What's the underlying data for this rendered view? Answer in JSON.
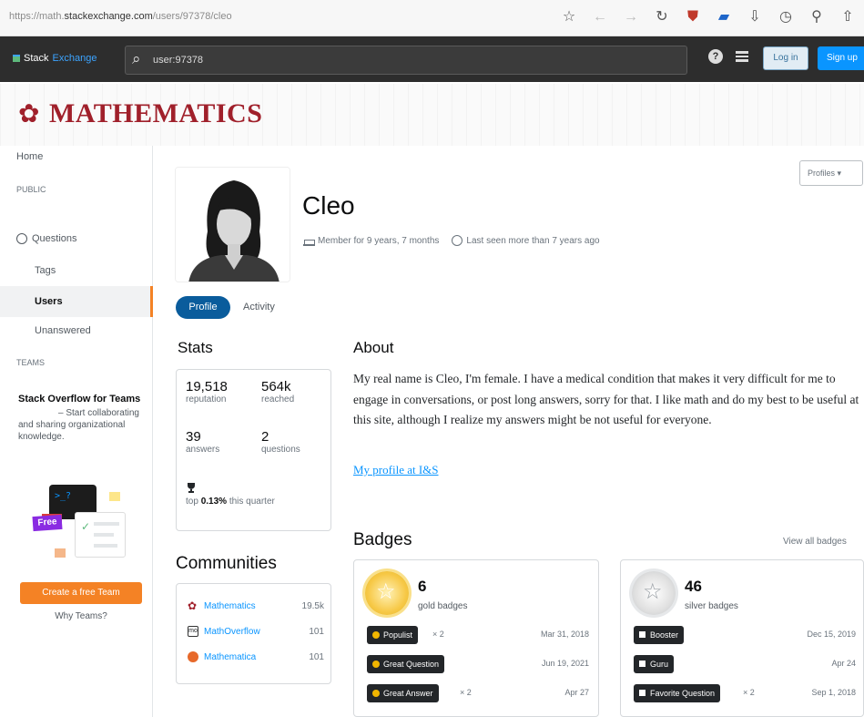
{
  "browser": {
    "url_prefix": "https://math.",
    "url_domain": "stackexchange.com",
    "url_path": "/users/97378/cleo"
  },
  "topbar": {
    "logo_stack": "Stack",
    "logo_exchange": "Exchange",
    "search_value": "user:97378",
    "help_icon": "?",
    "login_label": "Log in",
    "signup_label": "Sign up"
  },
  "site": {
    "name": "MATHEMATICS",
    "brand_color": "#a0202b"
  },
  "nav": {
    "home": "Home",
    "public_label": "PUBLIC",
    "questions": "Questions",
    "tags": "Tags",
    "users": "Users",
    "unanswered": "Unanswered",
    "teams_label": "TEAMS",
    "teams_title": "Stack Overflow for Teams",
    "teams_desc": "– Start collaborating and sharing organizational knowledge.",
    "illustration_prompt": ">_",
    "illustration_cursor": "?",
    "illustration_free": "Free",
    "create_team": "Create a free Team",
    "why_teams": "Why Teams?"
  },
  "profile": {
    "name": "Cleo",
    "member_for": "Member for 9 years, 7 months",
    "last_seen": "Last seen more than 7 years ago",
    "profiles_button": "Profiles ▾",
    "tab_profile": "Profile",
    "tab_activity": "Activity"
  },
  "stats": {
    "heading": "Stats",
    "reputation": "19,518",
    "reputation_label": "reputation",
    "reached": "564k",
    "reached_label": "reached",
    "answers": "39",
    "answers_label": "answers",
    "questions": "2",
    "questions_label": "questions",
    "top_prefix": "top ",
    "top_value": "0.13%",
    "top_suffix": " this quarter"
  },
  "communities": {
    "heading": "Communities",
    "items": [
      {
        "name": "Mathematics",
        "value": "19.5k",
        "icon": "mathematics-icon",
        "color": "#a0202b"
      },
      {
        "name": "MathOverflow",
        "value": "101",
        "icon": "mathoverflow-icon",
        "color": "#333333"
      },
      {
        "name": "Mathematica",
        "value": "101",
        "icon": "mathematica-icon",
        "color": "#e7692a"
      }
    ]
  },
  "about": {
    "heading": "About",
    "text": "My real name is Cleo, I'm female. I have a medical condition that makes it very difficult for me to engage in conversations, or post long answers, sorry for that. I like math and do my best to be useful at this site, although I realize my answers might be not useful for everyone.",
    "link": "My profile at I&S"
  },
  "badges": {
    "heading": "Badges",
    "view_all": "View all badges",
    "gold": {
      "count": "6",
      "label": "gold badges",
      "items": [
        {
          "name": "Populist",
          "mult": "× 2",
          "date": "Mar 31, 2018"
        },
        {
          "name": "Great Question",
          "mult": "",
          "date": "Jun 19, 2021"
        },
        {
          "name": "Great Answer",
          "mult": "× 2",
          "date": "Apr 27"
        }
      ]
    },
    "silver": {
      "count": "46",
      "label": "silver badges",
      "items": [
        {
          "name": "Booster",
          "mult": "",
          "date": "Dec 15, 2019"
        },
        {
          "name": "Guru",
          "mult": "",
          "date": "Apr 24"
        },
        {
          "name": "Favorite Question",
          "mult": "× 2",
          "date": "Sep 1, 2018"
        }
      ]
    },
    "colors": {
      "gold": "#f1b600",
      "silver": "#b4b8bc"
    }
  }
}
